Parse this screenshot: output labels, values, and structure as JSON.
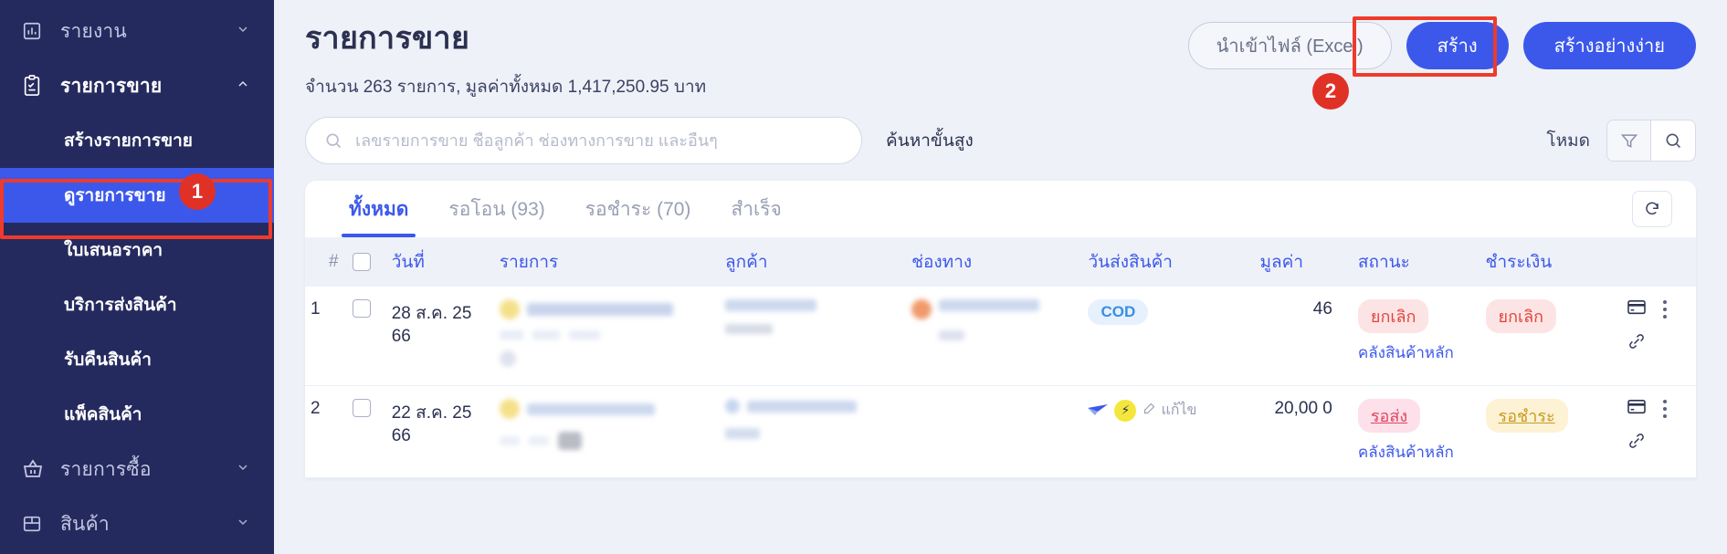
{
  "sidebar": {
    "groups": [
      {
        "id": "reports",
        "label": "รายงาน",
        "icon": "bar-chart-icon",
        "chevron": "chevron-down-icon",
        "active": false,
        "children": []
      },
      {
        "id": "sales",
        "label": "รายการขาย",
        "icon": "clipboard-check-icon",
        "chevron": "chevron-up-icon",
        "active": true,
        "children": [
          {
            "id": "create-sale",
            "label": "สร้างรายการขาย",
            "selected": false
          },
          {
            "id": "view-sale",
            "label": "ดูรายการขาย",
            "selected": true
          },
          {
            "id": "quotation",
            "label": "ใบเสนอราคา",
            "selected": false
          },
          {
            "id": "shipping-service",
            "label": "บริการส่งสินค้า",
            "selected": false
          },
          {
            "id": "returns",
            "label": "รับคืนสินค้า",
            "selected": false
          },
          {
            "id": "pack-goods",
            "label": "แพ็คสินค้า",
            "selected": false
          }
        ]
      },
      {
        "id": "purchases",
        "label": "รายการซื้อ",
        "icon": "basket-icon",
        "chevron": "chevron-down-icon",
        "active": false,
        "children": []
      },
      {
        "id": "products",
        "label": "สินค้า",
        "icon": "box-icon",
        "chevron": "chevron-down-icon",
        "active": false,
        "children": []
      }
    ]
  },
  "annotations": [
    {
      "number": "1",
      "target": "sidebar-item-view-sale"
    },
    {
      "number": "2",
      "target": "create-button"
    }
  ],
  "header": {
    "title": "รายการขาย",
    "subtitle": "จำนวน 263 รายการ, มูลค่าทั้งหมด 1,417,250.95 บาท",
    "count": "263",
    "total_value": "1,417,250.95",
    "import_label": "นำเข้าไฟล์ (Excel)",
    "create_label": "สร้าง",
    "create_simple_label": "สร้างอย่างง่าย"
  },
  "search": {
    "placeholder": "เลขรายการขาย ชื่อลูกค้า ช่องทางการขาย และอื่นๆ",
    "value": "",
    "icon": "search-icon",
    "advanced_label": "ค้นหาขั้นสูง",
    "mode_label": "โหมด",
    "filter_icon": "funnel-icon",
    "search_toggle_icon": "search-icon"
  },
  "tabs": [
    {
      "id": "all",
      "label": "ทั้งหมด",
      "active": true
    },
    {
      "id": "pending-transfer",
      "label": "รอโอน (93)",
      "active": false
    },
    {
      "id": "pending-payment",
      "label": "รอชำระ (70)",
      "active": false
    },
    {
      "id": "done",
      "label": "สำเร็จ",
      "active": false
    }
  ],
  "refresh_icon": "refresh-icon",
  "table": {
    "columns": [
      "#",
      "",
      "วันที่",
      "รายการ",
      "ลูกค้า",
      "ช่องทาง",
      "วันส่งสินค้า",
      "มูลค่า",
      "สถานะ",
      "ชำระเงิน",
      "",
      ""
    ],
    "rows": [
      {
        "index": "1",
        "date": "28 ส.ค. 25 66",
        "item_redacted": true,
        "customer_redacted": true,
        "channel_redacted": true,
        "delivery_date": "COD",
        "delivery_date_type": "cod",
        "value": "46",
        "status": "ยกเลิก",
        "status_type": "cancel",
        "status_sub": "คลังสินค้าหลัก",
        "payment": "ยกเลิก",
        "payment_type": "cancel",
        "card_icon": "credit-card-icon",
        "link_icon": "link-icon",
        "menu_icon": "kebab-menu-icon"
      },
      {
        "index": "2",
        "date": "22 ส.ค. 25 66",
        "item_redacted": true,
        "customer_redacted": true,
        "channel_redacted": false,
        "delivery_date": "แก้ไข",
        "delivery_date_type": "edit",
        "delivery_icons": [
          "thai-post-icon",
          "flash-express-icon",
          "edit-icon"
        ],
        "value": "20,00 0",
        "status": "รอส่ง",
        "status_type": "pending",
        "status_sub": "คลังสินค้าหลัก",
        "payment": "รอชำระ",
        "payment_type": "unpaid",
        "card_icon": "credit-card-icon",
        "link_icon": "link-icon",
        "menu_icon": "kebab-menu-icon"
      }
    ]
  },
  "colors": {
    "sidebar_bg": "#252a5e",
    "accent": "#3c58eb",
    "highlight": "#ee3b2b",
    "page_bg": "#eef1f8"
  }
}
